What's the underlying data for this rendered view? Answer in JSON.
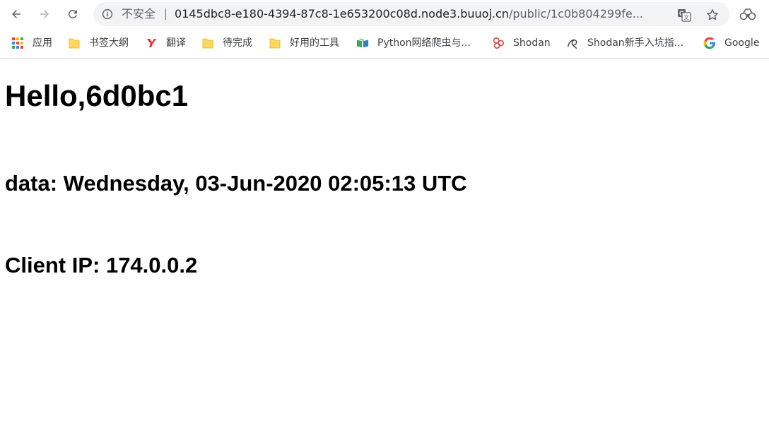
{
  "browser": {
    "security_label": "不安全",
    "url_host": "0145dbc8-e180-4394-87c8-1e653200c08d.node3.buuoj.cn",
    "url_path": "/public/1c0b804299fe..."
  },
  "bookmarks": [
    {
      "label": "应用",
      "icon": "apps-grid-icon"
    },
    {
      "label": "书签大纲",
      "icon": "folder-icon"
    },
    {
      "label": "翻译",
      "icon": "youdao-translate-icon"
    },
    {
      "label": "待完成",
      "icon": "folder-icon"
    },
    {
      "label": "好用的工具",
      "icon": "folder-icon"
    },
    {
      "label": "Python网络爬虫与...",
      "icon": "book-icon"
    },
    {
      "label": "Shodan",
      "icon": "shodan-logo-icon"
    },
    {
      "label": "Shodan新手入坑指...",
      "icon": "shodan-script-icon"
    },
    {
      "label": "Google",
      "icon": "google-g-icon"
    }
  ],
  "page": {
    "greeting": "Hello,6d0bc1",
    "date_line": "data: Wednesday, 03-Jun-2020 02:05:13 UTC",
    "ip_line": "Client IP: 174.0.0.2"
  },
  "colors": {
    "folder": "#fdd663",
    "google_blue": "#4285f4",
    "youdao_red": "#e8252b",
    "shodan_red": "#d9534f"
  }
}
